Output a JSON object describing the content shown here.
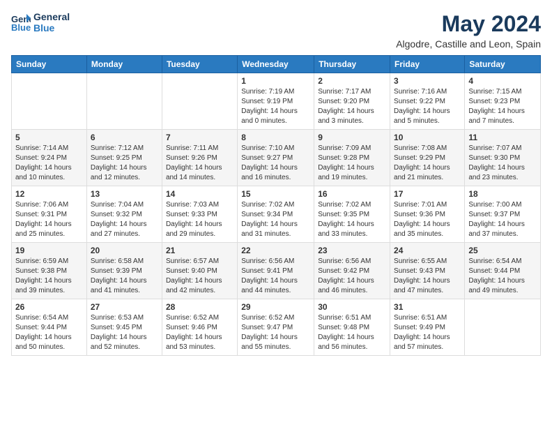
{
  "logo": {
    "line1": "General",
    "line2": "Blue"
  },
  "title": "May 2024",
  "location": "Algodre, Castille and Leon, Spain",
  "days_header": [
    "Sunday",
    "Monday",
    "Tuesday",
    "Wednesday",
    "Thursday",
    "Friday",
    "Saturday"
  ],
  "weeks": [
    [
      {
        "day": "",
        "content": ""
      },
      {
        "day": "",
        "content": ""
      },
      {
        "day": "",
        "content": ""
      },
      {
        "day": "1",
        "content": "Sunrise: 7:19 AM\nSunset: 9:19 PM\nDaylight: 14 hours\nand 0 minutes."
      },
      {
        "day": "2",
        "content": "Sunrise: 7:17 AM\nSunset: 9:20 PM\nDaylight: 14 hours\nand 3 minutes."
      },
      {
        "day": "3",
        "content": "Sunrise: 7:16 AM\nSunset: 9:22 PM\nDaylight: 14 hours\nand 5 minutes."
      },
      {
        "day": "4",
        "content": "Sunrise: 7:15 AM\nSunset: 9:23 PM\nDaylight: 14 hours\nand 7 minutes."
      }
    ],
    [
      {
        "day": "5",
        "content": "Sunrise: 7:14 AM\nSunset: 9:24 PM\nDaylight: 14 hours\nand 10 minutes."
      },
      {
        "day": "6",
        "content": "Sunrise: 7:12 AM\nSunset: 9:25 PM\nDaylight: 14 hours\nand 12 minutes."
      },
      {
        "day": "7",
        "content": "Sunrise: 7:11 AM\nSunset: 9:26 PM\nDaylight: 14 hours\nand 14 minutes."
      },
      {
        "day": "8",
        "content": "Sunrise: 7:10 AM\nSunset: 9:27 PM\nDaylight: 14 hours\nand 16 minutes."
      },
      {
        "day": "9",
        "content": "Sunrise: 7:09 AM\nSunset: 9:28 PM\nDaylight: 14 hours\nand 19 minutes."
      },
      {
        "day": "10",
        "content": "Sunrise: 7:08 AM\nSunset: 9:29 PM\nDaylight: 14 hours\nand 21 minutes."
      },
      {
        "day": "11",
        "content": "Sunrise: 7:07 AM\nSunset: 9:30 PM\nDaylight: 14 hours\nand 23 minutes."
      }
    ],
    [
      {
        "day": "12",
        "content": "Sunrise: 7:06 AM\nSunset: 9:31 PM\nDaylight: 14 hours\nand 25 minutes."
      },
      {
        "day": "13",
        "content": "Sunrise: 7:04 AM\nSunset: 9:32 PM\nDaylight: 14 hours\nand 27 minutes."
      },
      {
        "day": "14",
        "content": "Sunrise: 7:03 AM\nSunset: 9:33 PM\nDaylight: 14 hours\nand 29 minutes."
      },
      {
        "day": "15",
        "content": "Sunrise: 7:02 AM\nSunset: 9:34 PM\nDaylight: 14 hours\nand 31 minutes."
      },
      {
        "day": "16",
        "content": "Sunrise: 7:02 AM\nSunset: 9:35 PM\nDaylight: 14 hours\nand 33 minutes."
      },
      {
        "day": "17",
        "content": "Sunrise: 7:01 AM\nSunset: 9:36 PM\nDaylight: 14 hours\nand 35 minutes."
      },
      {
        "day": "18",
        "content": "Sunrise: 7:00 AM\nSunset: 9:37 PM\nDaylight: 14 hours\nand 37 minutes."
      }
    ],
    [
      {
        "day": "19",
        "content": "Sunrise: 6:59 AM\nSunset: 9:38 PM\nDaylight: 14 hours\nand 39 minutes."
      },
      {
        "day": "20",
        "content": "Sunrise: 6:58 AM\nSunset: 9:39 PM\nDaylight: 14 hours\nand 41 minutes."
      },
      {
        "day": "21",
        "content": "Sunrise: 6:57 AM\nSunset: 9:40 PM\nDaylight: 14 hours\nand 42 minutes."
      },
      {
        "day": "22",
        "content": "Sunrise: 6:56 AM\nSunset: 9:41 PM\nDaylight: 14 hours\nand 44 minutes."
      },
      {
        "day": "23",
        "content": "Sunrise: 6:56 AM\nSunset: 9:42 PM\nDaylight: 14 hours\nand 46 minutes."
      },
      {
        "day": "24",
        "content": "Sunrise: 6:55 AM\nSunset: 9:43 PM\nDaylight: 14 hours\nand 47 minutes."
      },
      {
        "day": "25",
        "content": "Sunrise: 6:54 AM\nSunset: 9:44 PM\nDaylight: 14 hours\nand 49 minutes."
      }
    ],
    [
      {
        "day": "26",
        "content": "Sunrise: 6:54 AM\nSunset: 9:44 PM\nDaylight: 14 hours\nand 50 minutes."
      },
      {
        "day": "27",
        "content": "Sunrise: 6:53 AM\nSunset: 9:45 PM\nDaylight: 14 hours\nand 52 minutes."
      },
      {
        "day": "28",
        "content": "Sunrise: 6:52 AM\nSunset: 9:46 PM\nDaylight: 14 hours\nand 53 minutes."
      },
      {
        "day": "29",
        "content": "Sunrise: 6:52 AM\nSunset: 9:47 PM\nDaylight: 14 hours\nand 55 minutes."
      },
      {
        "day": "30",
        "content": "Sunrise: 6:51 AM\nSunset: 9:48 PM\nDaylight: 14 hours\nand 56 minutes."
      },
      {
        "day": "31",
        "content": "Sunrise: 6:51 AM\nSunset: 9:49 PM\nDaylight: 14 hours\nand 57 minutes."
      },
      {
        "day": "",
        "content": ""
      }
    ]
  ]
}
